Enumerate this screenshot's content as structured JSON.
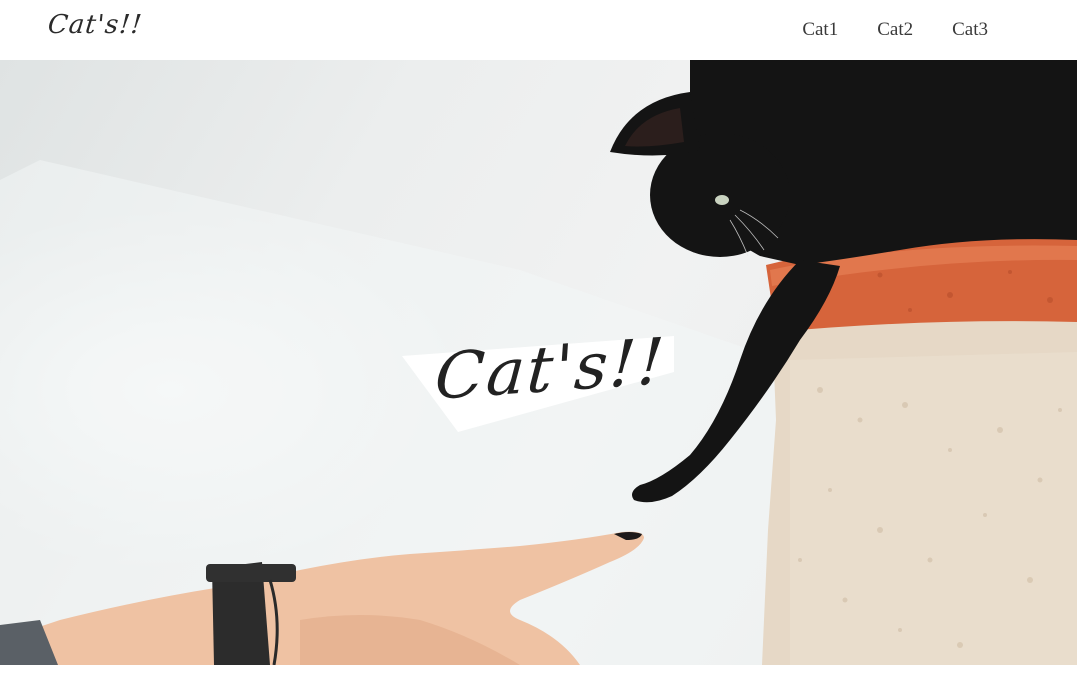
{
  "header": {
    "logo_text": "Cat's!!",
    "nav": [
      {
        "label": "Cat1"
      },
      {
        "label": "Cat2"
      },
      {
        "label": "Cat3"
      }
    ]
  },
  "hero": {
    "title": "Cat's!!"
  },
  "colors": {
    "text": "#2b2b2b",
    "nav_text": "#3a3a3a",
    "background": "#ffffff",
    "wall": "#eceeee",
    "cat": "#141414",
    "pot": "#d8693f",
    "pillar": "#e9dccb",
    "skin": "#f0c4a6",
    "watch": "#2c2c2c"
  }
}
